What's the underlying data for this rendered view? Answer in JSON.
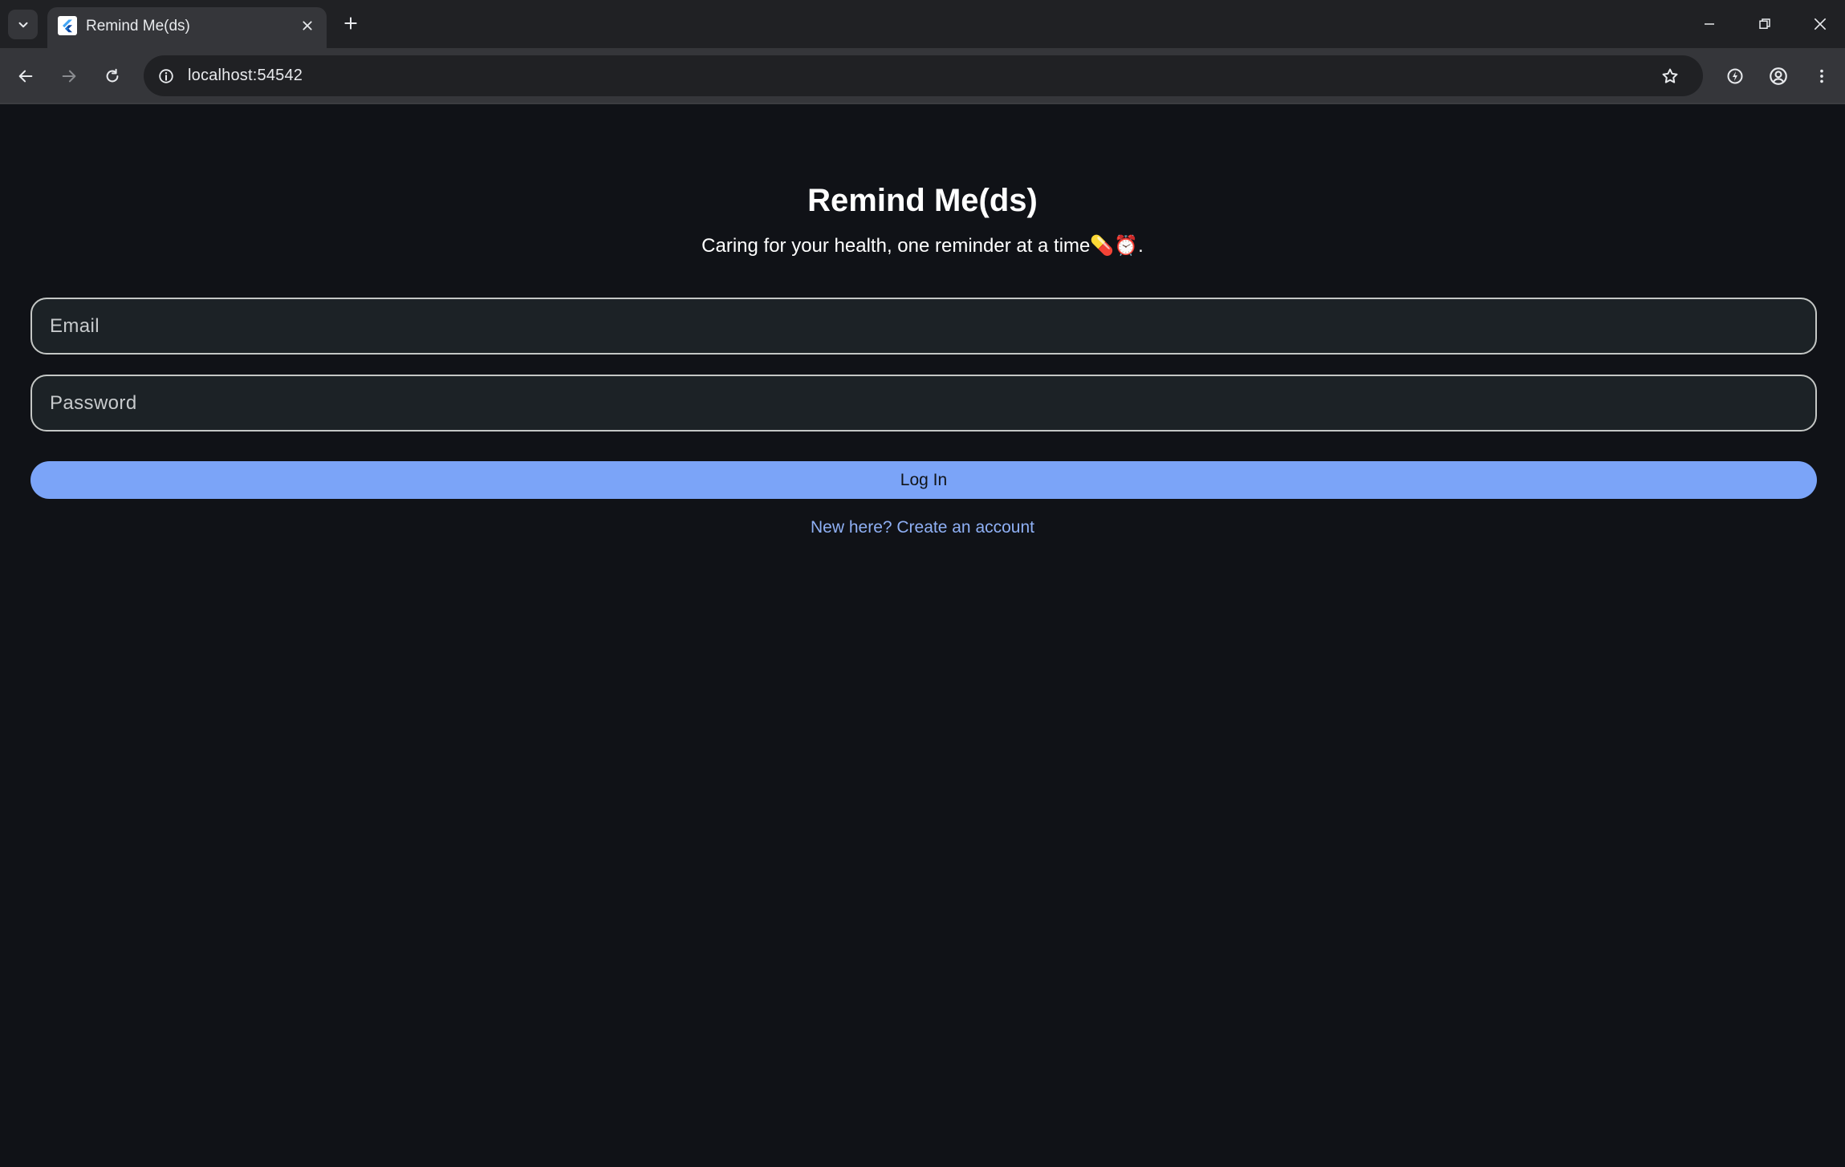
{
  "browser": {
    "tab_title": "Remind Me(ds)",
    "url": "localhost:54542",
    "icons": {
      "tab_search": "chevron-down-icon",
      "favicon": "flutter-icon",
      "tab_close": "close-icon",
      "new_tab": "plus-icon",
      "back": "arrow-left-icon",
      "forward": "arrow-right-icon",
      "reload": "reload-icon",
      "site_info": "info-icon",
      "bookmark": "star-icon",
      "extension": "lightning-icon",
      "profile": "account-icon",
      "menu": "kebab-icon",
      "minimize": "minimize-icon",
      "restore": "restore-icon",
      "close_window": "close-icon"
    }
  },
  "app": {
    "title": "Remind Me(ds)",
    "subtitle": "Caring for your health, one reminder at a time💊⏰.",
    "email_placeholder": "Email",
    "password_placeholder": "Password",
    "login_label": "Log In",
    "signup_link": "New here? Create an account"
  },
  "colors": {
    "background": "#101217",
    "field_background": "#1c2226",
    "field_border": "#c4c7c5",
    "primary_button": "#7ba4f8",
    "link": "#8fb0f5",
    "chrome_dark": "#202124",
    "chrome_toolbar": "#35363a"
  }
}
